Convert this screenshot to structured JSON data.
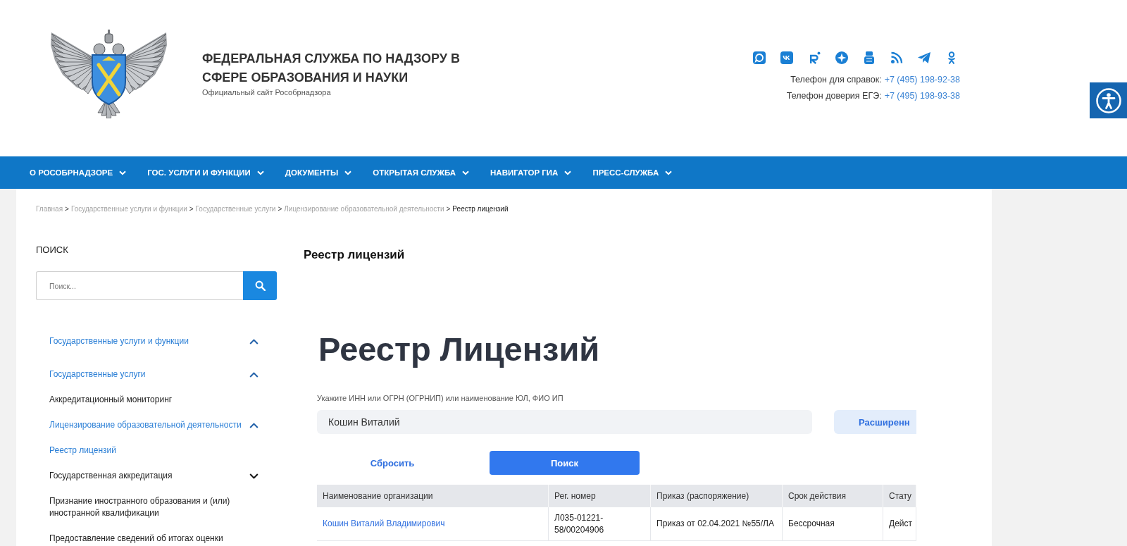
{
  "header": {
    "title": "ФЕДЕРАЛЬНАЯ СЛУЖБА ПО НАДЗОРУ В СФЕРЕ ОБРАЗОВАНИЯ И НАУКИ",
    "subtitle": "Официальный сайт Рособрнадзора",
    "phones": [
      {
        "label": "Телефон для справок:",
        "number": "+7 (495) 198-92-38"
      },
      {
        "label": "Телефон доверия ЕГЭ:",
        "number": "+7 (495) 198-93-38"
      }
    ]
  },
  "nav": [
    "О РОСОБРНАДЗОРЕ",
    "ГОС. УСЛУГИ И ФУНКЦИИ",
    "ДОКУМЕНТЫ",
    "ОТКРЫТАЯ СЛУЖБА",
    "НАВИГАТОР ГИА",
    "ПРЕСС-СЛУЖБА"
  ],
  "breadcrumb": [
    {
      "label": "Главная",
      "current": false,
      "separator": ">"
    },
    {
      "label": "Государственные услуги и функции",
      "current": false,
      "separator": ">"
    },
    {
      "label": "Государственные услуги",
      "current": false,
      "separator": ">"
    },
    {
      "label": "Лицензирование образовательной деятельности",
      "current": false,
      "separator": ">"
    },
    {
      "label": "Реестр лицензий",
      "current": true
    }
  ],
  "sidebar": {
    "heading": "ПОИСК",
    "search": {
      "placeholder": "Поиск..."
    },
    "menu": [
      {
        "kind": "group",
        "label": "Государственные услуги и функции",
        "active": true,
        "expanded": true
      },
      {
        "kind": "group",
        "label": "Государственные услуги",
        "active": true,
        "expanded": true
      },
      {
        "kind": "link",
        "label": "Аккредитационный мониторинг",
        "active": false
      },
      {
        "kind": "group",
        "label": "Лицензирование образовательной деятельности",
        "active": true,
        "expanded": true
      },
      {
        "kind": "link",
        "label": "Реестр лицензий",
        "active": true
      },
      {
        "kind": "group",
        "label": "Государственная аккредитация",
        "active": false,
        "expanded": false
      },
      {
        "kind": "link",
        "label": "Признание иностранного образования и (или) иностранной квалификации",
        "active": false
      },
      {
        "kind": "link",
        "label": "Предоставление сведений об итогах оценки",
        "active": false
      }
    ]
  },
  "main": {
    "title": "Реестр лицензий",
    "heading": "Реестр Лицензий",
    "search": {
      "label": "Укажите ИНН или ОГРН (ОГРНИП) или наименование ЮЛ, ФИО ИП",
      "value": "Кошин Виталий"
    },
    "buttons": {
      "advanced": "Расширенн",
      "reset": "Сбросить",
      "search": "Поиск"
    },
    "table": {
      "columns": [
        "Наименование организации",
        "Рег. номер",
        "Приказ (распоряжение)",
        "Срок действия",
        "Стату"
      ],
      "rows": [
        [
          "Кошин Виталий Владимирович",
          "Л035-01221-58/00204906",
          "Приказ от 02.04.2021 №55/ЛА",
          "Бессрочная",
          "Дейст"
        ]
      ]
    }
  }
}
